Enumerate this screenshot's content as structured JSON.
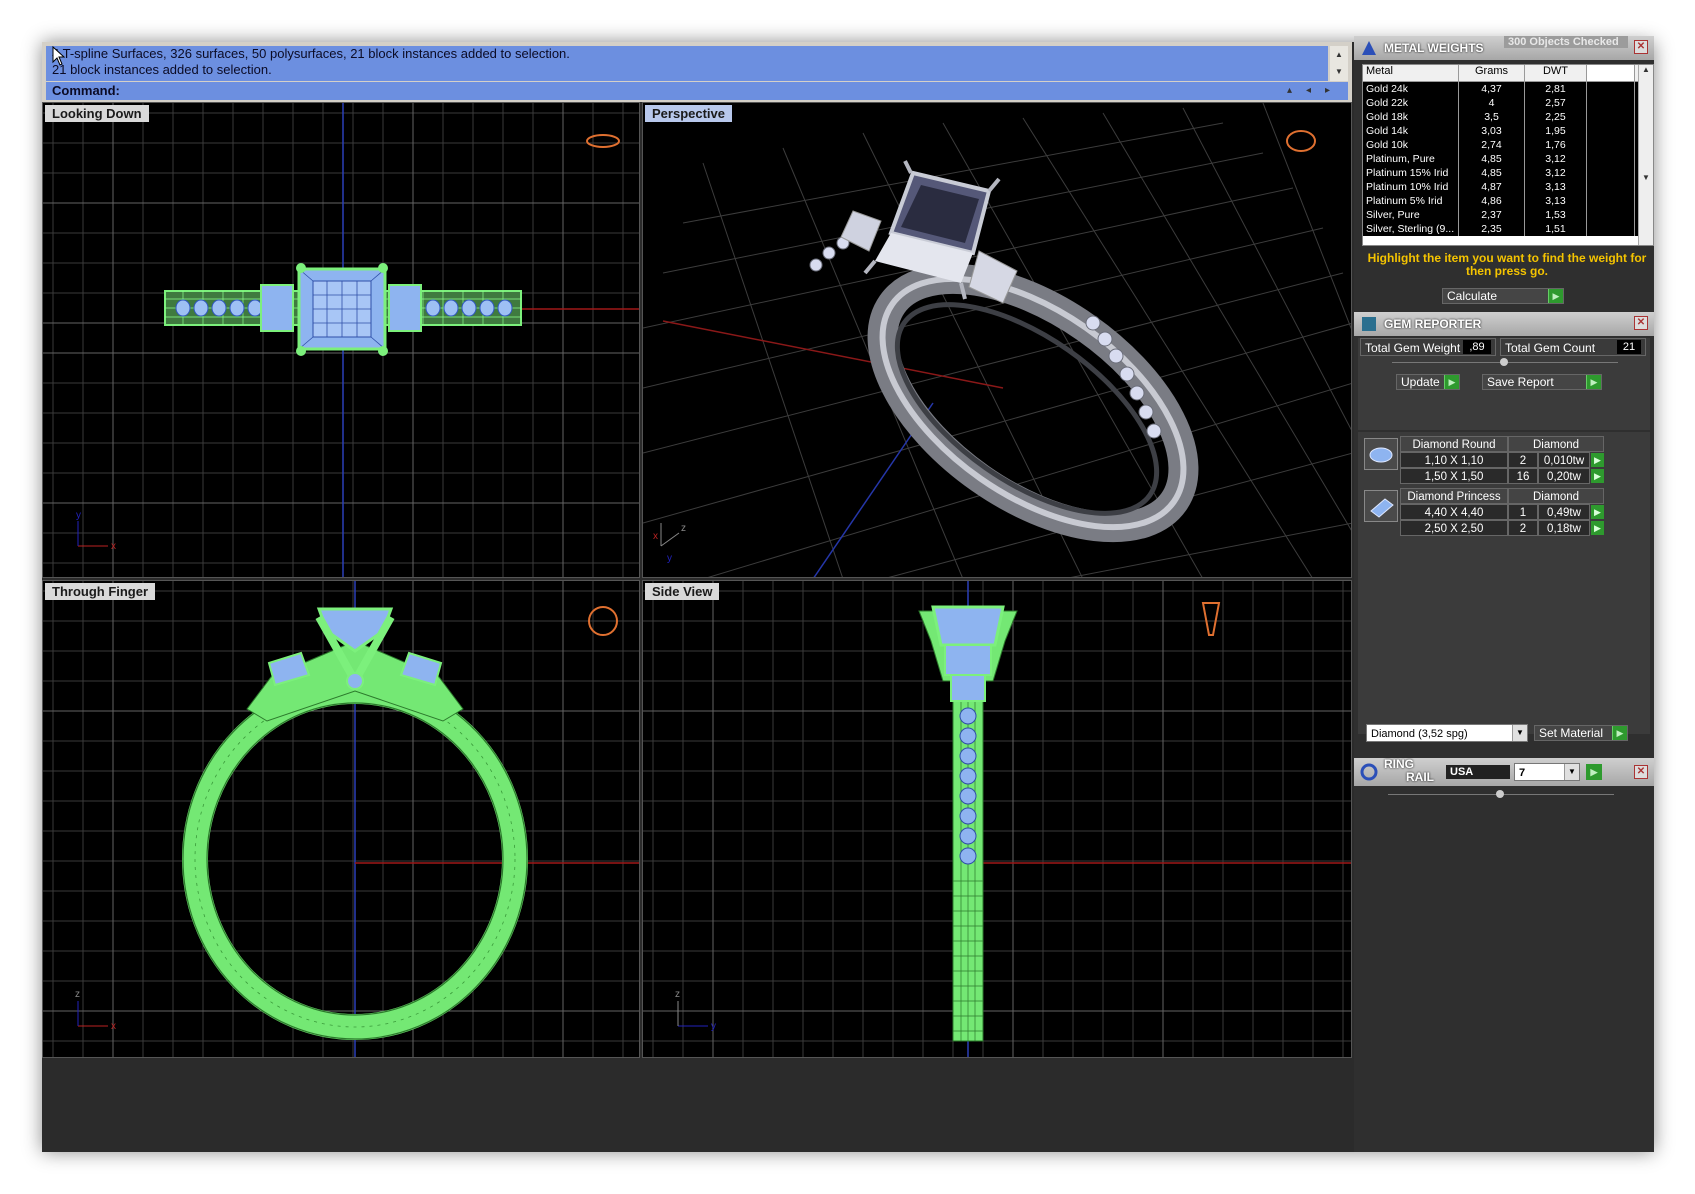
{
  "command": {
    "history": [
      "4 T-spline Surfaces, 326 surfaces, 50 polysurfaces, 21 block instances added to selection.",
      "21 block instances added to selection."
    ],
    "prompt": "Command:"
  },
  "viewports": {
    "top_left": {
      "label": "Looking Down",
      "axis_x": "x",
      "axis_y": "y"
    },
    "top_right": {
      "label": "Perspective",
      "axis_x": "x",
      "axis_y": "y",
      "axis_z": "z"
    },
    "bottom_left": {
      "label": "Through Finger",
      "axis_x": "x",
      "axis_z": "z"
    },
    "bottom_right": {
      "label": "Side View",
      "axis_y": "y",
      "axis_z": "z"
    }
  },
  "metal_weights": {
    "title": "METAL WEIGHTS",
    "subtitle": "300 Objects Checked",
    "columns": [
      "Metal",
      "Grams",
      "DWT"
    ],
    "rows": [
      [
        "Gold 24k",
        "4,37",
        "2,81"
      ],
      [
        "Gold 22k",
        "4",
        "2,57"
      ],
      [
        "Gold 18k",
        "3,5",
        "2,25"
      ],
      [
        "Gold 14k",
        "3,03",
        "1,95"
      ],
      [
        "Gold 10k",
        "2,74",
        "1,76"
      ],
      [
        "Platinum, Pure",
        "4,85",
        "3,12"
      ],
      [
        "Platinum 15% Irid",
        "4,85",
        "3,12"
      ],
      [
        "Platinum 10% Irid",
        "4,87",
        "3,13"
      ],
      [
        "Platinum 5% Irid",
        "4,86",
        "3,13"
      ],
      [
        "Silver, Pure",
        "2,37",
        "1,53"
      ],
      [
        "Silver, Sterling (9...",
        "2,35",
        "1,51"
      ]
    ],
    "hint": "Highlight the item you want to find the weight for then press go.",
    "calculate_label": "Calculate"
  },
  "gem_reporter": {
    "title": "GEM REPORTER",
    "total_weight_label": "Total Gem Weight",
    "total_weight_value": ",89",
    "total_count_label": "Total Gem Count",
    "total_count_value": "21",
    "update_label": "Update",
    "save_report_label": "Save Report",
    "groups": [
      {
        "shape": "Diamond Round",
        "material": "Diamond",
        "rows": [
          [
            "1,10 X 1,10",
            "2",
            "0,010tw"
          ],
          [
            "1,50 X 1,50",
            "16",
            "0,20tw"
          ]
        ]
      },
      {
        "shape": "Diamond Princess",
        "material": "Diamond",
        "rows": [
          [
            "4,40 X 4,40",
            "1",
            "0,49tw"
          ],
          [
            "2,50 X 2,50",
            "2",
            "0,18tw"
          ]
        ]
      }
    ],
    "material_select": "Diamond    (3,52 spg)",
    "set_material_label": "Set Material"
  },
  "ring_rail": {
    "title_line1": "RING",
    "title_line2": "RAIL",
    "region": "USA",
    "size": "7"
  },
  "colors": {
    "wire_green": "#7cf07c",
    "gem_blue": "#8eb4f0",
    "command_blue": "#6c8fe0",
    "hint_yellow": "#f5c400"
  }
}
